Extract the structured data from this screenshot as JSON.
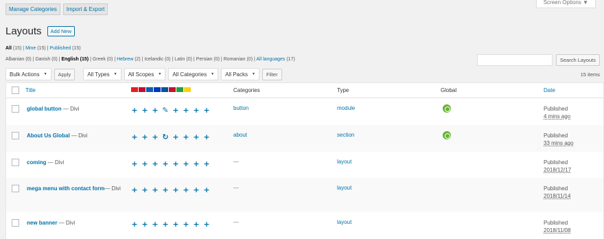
{
  "top_tabs": [
    "Manage Categories",
    "Import & Export"
  ],
  "screen_options": "Screen Options ▼",
  "page_title": "Layouts",
  "add_new": "Add New",
  "filters": {
    "all": "All",
    "all_count": "(15)",
    "sep1": " | ",
    "mine": "Mine",
    "mine_count": "(15)",
    "sep2": " | ",
    "published": "Published",
    "published_count": "(15)"
  },
  "languages": {
    "plain": "Albanian (0) | Danish (0) | ",
    "bold": "English (15)",
    "mid": " | Greek (0) | ",
    "hebrew": "Hebrew",
    "after_hebrew": " (2) | Icelandic (0) | Latin (0) | Persian (0) | Romanian (0) | ",
    "all_languages": "All languages",
    "all_count": " (17)"
  },
  "search_button": "Search Layouts",
  "bulk_actions": "Bulk Actions",
  "apply": "Apply",
  "all_types": "All Types",
  "all_scopes": "All Scopes",
  "all_categories": "All Categories",
  "all_packs": "All Packs",
  "filter": "Filter",
  "items_count": "15 items",
  "columns": {
    "title": "Title",
    "categories": "Categories",
    "type": "Type",
    "global": "Global",
    "date": "Date"
  },
  "flag_colors": [
    "#e41e20",
    "#c60c30",
    "#0d5eaf",
    "#0038b8",
    "#02529c",
    "#c8102e",
    "#239f40",
    "#fcd116"
  ],
  "rows": [
    {
      "name": "global button",
      "suffix": " — Divi",
      "pluses": [
        "+",
        "+",
        "+",
        "✎",
        "+",
        "+",
        "+",
        "+"
      ],
      "category": "button",
      "type": "module",
      "global": true,
      "status": "Published",
      "date": "4 mins ago"
    },
    {
      "name": "About Us Global",
      "suffix": " — Divi",
      "pluses": [
        "+",
        "+",
        "+",
        "↻",
        "+",
        "+",
        "+",
        "+"
      ],
      "category": "about",
      "type": "section",
      "global": true,
      "status": "Published",
      "date": "33 mins ago"
    },
    {
      "name": "coming",
      "suffix": " — Divi",
      "pluses": [
        "+",
        "+",
        "+",
        "+",
        "+",
        "+",
        "+",
        "+"
      ],
      "category": "—",
      "type": "layout",
      "global": false,
      "status": "Published",
      "date": "2018/12/17"
    },
    {
      "name": "mega menu with contact form",
      "suffix": "— Divi",
      "pluses": [
        "+",
        "+",
        "+",
        "+",
        "+",
        "+",
        "+",
        "+"
      ],
      "category": "—",
      "type": "layout",
      "global": false,
      "status": "Published",
      "date": "2018/11/14"
    },
    {
      "name": "new banner",
      "suffix": " — Divi",
      "pluses": [
        "+",
        "+",
        "+",
        "+",
        "+",
        "+",
        "+",
        "+"
      ],
      "category": "—",
      "type": "layout",
      "global": false,
      "status": "Published",
      "date": "2018/11/08"
    }
  ]
}
